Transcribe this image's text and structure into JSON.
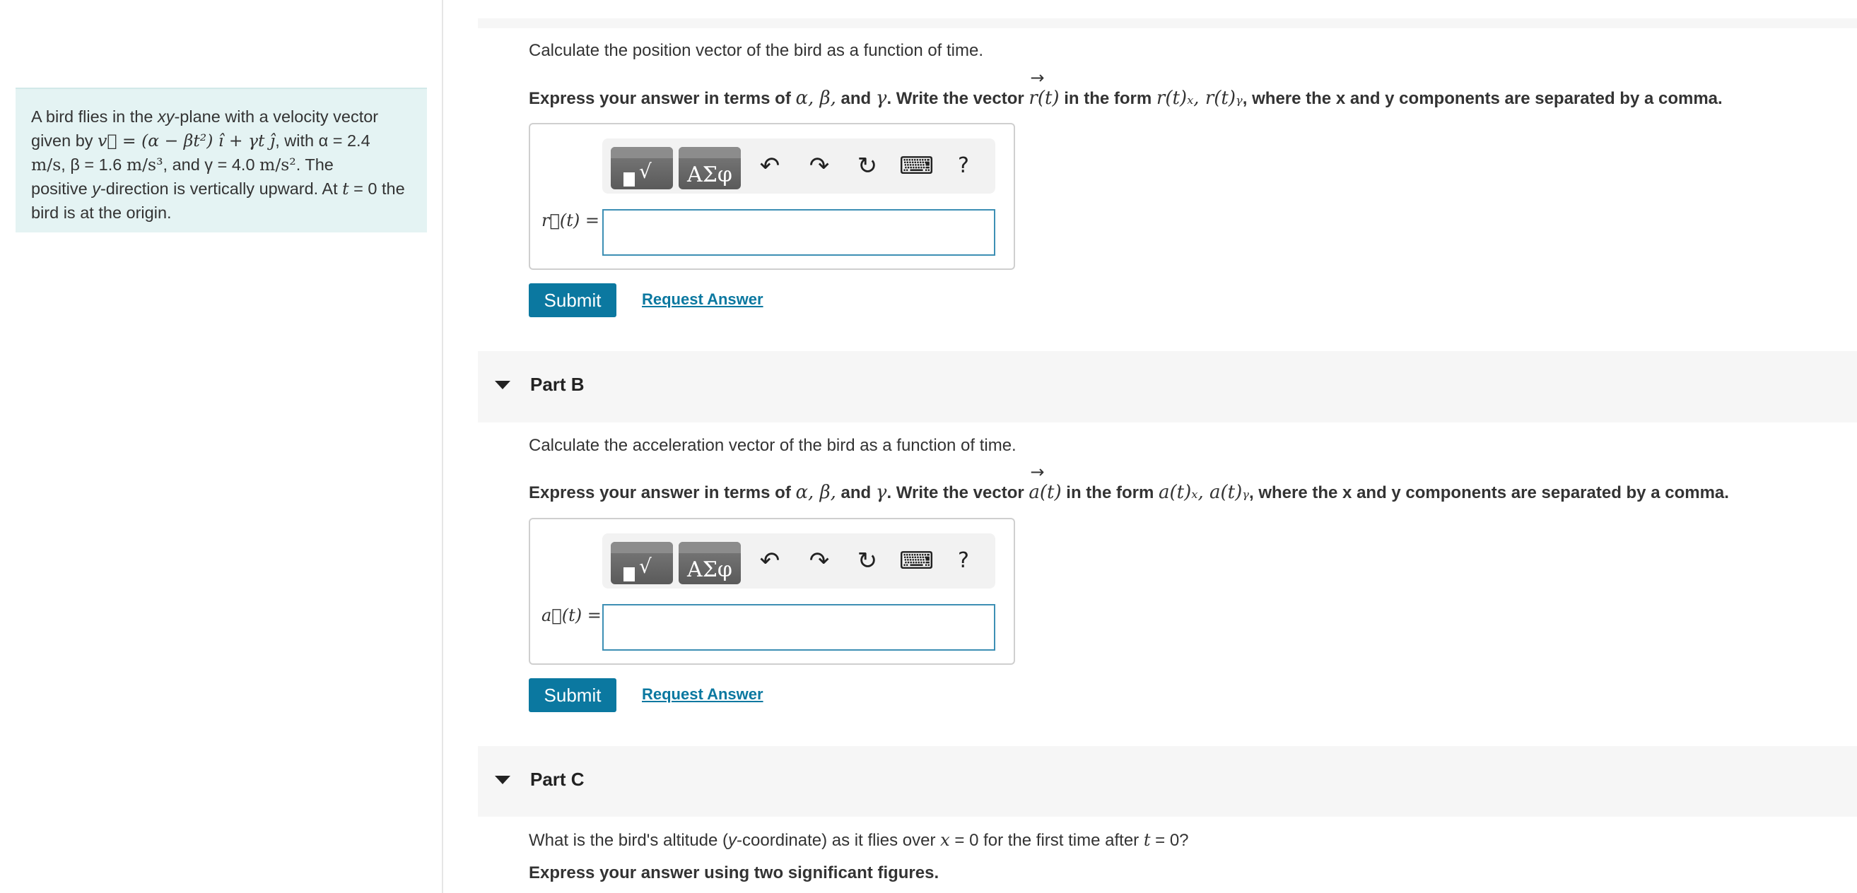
{
  "problem": {
    "line1_pre": "A bird flies in the ",
    "line1_xy": "xy",
    "line1_post": "-plane with a velocity vector",
    "line2_pre": "given by ",
    "line2_math": "v⃗ = (α − βt²) î + γt ĵ",
    "line2_post": ", with α = 2.4",
    "line3_unit1": "m/s",
    "line3_mid1": ", β = 1.6 ",
    "line3_unit2": "m/s³",
    "line3_mid2": ", and γ = 4.0 ",
    "line3_unit3": "m/s²",
    "line3_post": ". The",
    "line4_pre": "positive ",
    "line4_y": "y",
    "line4_mid": "-direction is vertically upward. At ",
    "line4_t": "t",
    "line4_post": " = 0 the",
    "line5": "bird is at the origin."
  },
  "partA": {
    "prompt": "Calculate the position vector of the bird as a function of time.",
    "instr_pre": "Express your answer in terms of ",
    "instr_vars": "α, β,",
    "instr_and": " and ",
    "instr_gamma": "γ",
    "instr_mid": ". Write the vector ",
    "instr_vec": "r(t)",
    "instr_form_pre": " in the form ",
    "instr_form": "r(t)ₓ, r(t)ᵧ",
    "instr_post": ", where the x and y components are separated by a comma.",
    "answer_label": "r⃗(t) =",
    "submit_label": "Submit",
    "request_label": "Request Answer"
  },
  "partB": {
    "title": "Part B",
    "prompt": "Calculate the acceleration vector of the bird as a function of time.",
    "instr_pre": "Express your answer in terms of ",
    "instr_vars": "α, β,",
    "instr_and": " and ",
    "instr_gamma": "γ",
    "instr_mid": ". Write the vector ",
    "instr_vec": "a(t)",
    "instr_form_pre": " in the form ",
    "instr_form": "a(t)ₓ, a(t)ᵧ",
    "instr_post": ", where the x and y components are separated by a comma.",
    "answer_label": "a⃗(t) =",
    "submit_label": "Submit",
    "request_label": "Request Answer"
  },
  "partC": {
    "title": "Part C",
    "prompt_pre": "What is the bird's altitude (",
    "prompt_y": "y",
    "prompt_mid": "-coordinate) as it flies over ",
    "prompt_x": "x",
    "prompt_mid2": " = 0 for the first time after ",
    "prompt_t": "t",
    "prompt_post": " = 0?",
    "instr": "Express your answer using two significant figures."
  },
  "toolbar": {
    "greek_label": "ΑΣφ",
    "undo_icon": "↶",
    "redo_icon": "↷",
    "reset_icon": "↻",
    "keyboard_icon": "⌨",
    "help_label": "?"
  },
  "colors": {
    "problem_bg": "#e4f3f3",
    "accent": "#0b78a0",
    "input_border": "#3d8fb4",
    "band": "#f6f6f6"
  }
}
